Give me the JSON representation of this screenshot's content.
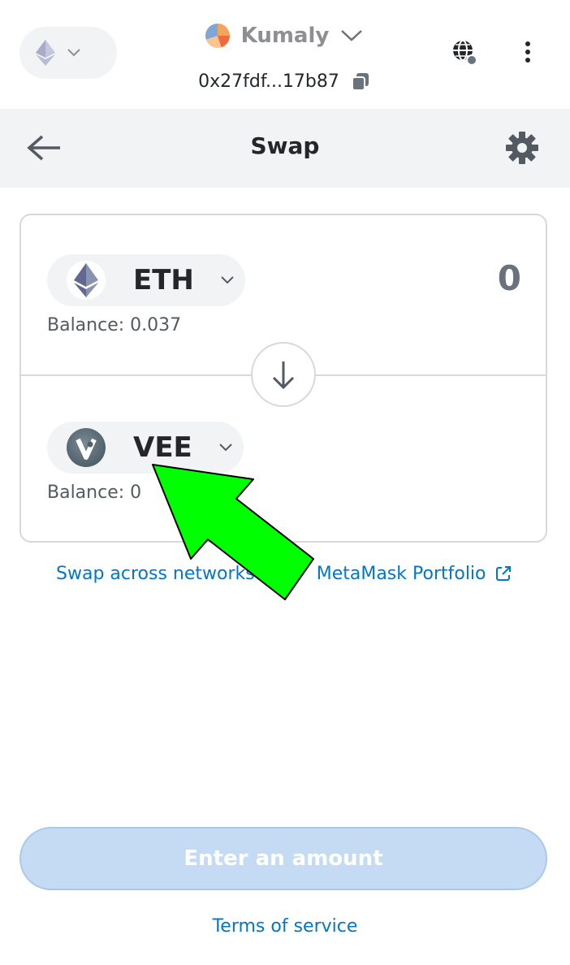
{
  "header": {
    "network_icon": "ethereum-icon",
    "account_name": "Kumaly",
    "address": "0x27fdf...17b87",
    "icons": [
      "chevron-down-icon",
      "copy-icon",
      "globe-icon",
      "kebab-menu-icon"
    ]
  },
  "subheader": {
    "title": "Swap",
    "back_icon": "arrow-left-icon",
    "settings_icon": "gear-icon"
  },
  "swap": {
    "from": {
      "symbol": "ETH",
      "amount": "0",
      "balance": "Balance: 0.037"
    },
    "to": {
      "symbol": "VEE",
      "balance": "Balance: 0"
    },
    "direction_icon": "arrow-down-icon"
  },
  "links": {
    "cross_network": "Swap across networks with MetaMask Portfolio",
    "cross_network_visible": "Swap across networks",
    "cross_network_tail": "MetaMask Portfolio",
    "terms": "Terms of service"
  },
  "actions": {
    "primary_label": "Enter an amount"
  },
  "colors": {
    "accent": "#0376c9",
    "disabled_button": "#c5dbf3",
    "annotation_arrow": "#00ff00"
  }
}
